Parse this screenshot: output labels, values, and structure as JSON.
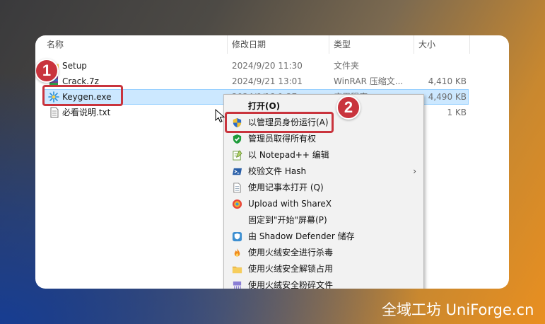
{
  "colors": {
    "accent": "#c9343d",
    "selection": "#cce8ff",
    "menu_bg": "#f2f2f2"
  },
  "columns": {
    "name": "名称",
    "modified": "修改日期",
    "type": "类型",
    "size": "大小"
  },
  "files": [
    {
      "icon": "folder-icon",
      "name": "Setup",
      "modified": "2024/9/20 11:30",
      "type": "文件夹",
      "size": ""
    },
    {
      "icon": "archive-icon",
      "name": "Crack.7z",
      "modified": "2024/9/21 13:01",
      "type": "WinRAR 压缩文...",
      "size": "4,410 KB"
    },
    {
      "icon": "keygen-app-icon",
      "name": "Keygen.exe",
      "modified": "2024/9/18 1:27",
      "type": "应用程序",
      "size": "4,490 KB",
      "selected": true
    },
    {
      "icon": "text-file-icon",
      "name": "必看说明.txt",
      "modified": "",
      "type": "",
      "size": "1 KB"
    }
  ],
  "context_menu": {
    "items": [
      {
        "label": "打开(O)",
        "icon": "",
        "bold": true
      },
      {
        "label": "以管理员身份运行(A)",
        "icon": "uac-shield-icon"
      },
      {
        "label": "管理员取得所有权",
        "icon": "green-shield-icon"
      },
      {
        "label": "以 Notepad++ 编辑",
        "icon": "notepadpp-icon"
      },
      {
        "label": "校验文件 Hash",
        "icon": "powershell-icon",
        "submenu": true
      },
      {
        "label": "使用记事本打开 (Q)",
        "icon": "notepad-icon"
      },
      {
        "label": "Upload with ShareX",
        "icon": "sharex-icon"
      },
      {
        "label": "固定到\"开始\"屏幕(P)",
        "icon": ""
      },
      {
        "label": "由 Shadow Defender 储存",
        "icon": "shadow-defender-icon"
      },
      {
        "label": "使用火绒安全进行杀毒",
        "icon": "huorong-icon"
      },
      {
        "label": "使用火绒安全解锁占用",
        "icon": "folder-unlock-icon"
      },
      {
        "label": "使用火绒安全粉碎文件",
        "icon": "shredder-icon"
      }
    ]
  },
  "annotations": {
    "step1": "1",
    "step2": "2"
  },
  "watermark": "全域工坊 UniForge.cn"
}
